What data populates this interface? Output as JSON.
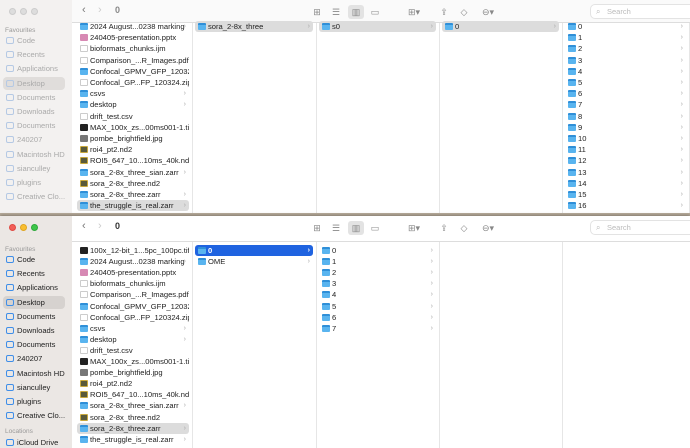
{
  "sidebar": {
    "heading": "Favourites",
    "items": [
      "Code",
      "Recents",
      "Applications",
      "Desktop",
      "Documents",
      "Downloads",
      "Documents",
      "240207",
      "Macintosh HD",
      "sianculley",
      "plugins",
      "Creative Clo..."
    ],
    "selected": "Desktop",
    "locations_heading": "Locations",
    "locations": [
      "iCloud Drive"
    ]
  },
  "window1": {
    "title": "0",
    "columns": [
      [
        {
          "n": "2024 August...0238 marking",
          "t": "folder",
          "c": 1
        },
        {
          "n": "240405-presentation.pptx",
          "t": "ppt"
        },
        {
          "n": "bioformats_chunks.ijm",
          "t": "doc"
        },
        {
          "n": "Comparison_...R_Images.pdf",
          "t": "doc"
        },
        {
          "n": "Confocal_GPMV_GFP_120324",
          "t": "folder",
          "c": 1
        },
        {
          "n": "Confocal_GP...FP_120324.zip",
          "t": "doc"
        },
        {
          "n": "csvs",
          "t": "folder",
          "c": 1
        },
        {
          "n": "desktop",
          "t": "folder",
          "c": 1
        },
        {
          "n": "drift_test.csv",
          "t": "doc"
        },
        {
          "n": "MAX_100x_zs...00ms001-1.tif",
          "t": "img"
        },
        {
          "n": "pombe_brightfield.jpg",
          "t": "jpg"
        },
        {
          "n": "roi4_pt2.nd2",
          "t": "nd2"
        },
        {
          "n": "ROI5_647_10...10ms_40k.nd2",
          "t": "nd2"
        },
        {
          "n": "sora_2-8x_three_sian.zarr",
          "t": "folder",
          "c": 1
        },
        {
          "n": "sora_2-8x_three.nd2",
          "t": "nd2"
        },
        {
          "n": "sora_2-8x_three.zarr",
          "t": "folder",
          "c": 1
        },
        {
          "n": "the_struggle_is_real.zarr",
          "t": "folder",
          "c": 1,
          "s": 1
        }
      ],
      [
        {
          "n": "sora_2-8x_three",
          "t": "folder",
          "c": 1,
          "s": 1
        }
      ],
      [
        {
          "n": "s0",
          "t": "folder",
          "c": 1,
          "s": 1
        }
      ],
      [
        {
          "n": "0",
          "t": "folder",
          "c": 1,
          "s": 1
        }
      ],
      [
        {
          "n": "0",
          "t": "folder",
          "c": 1
        },
        {
          "n": "1",
          "t": "folder",
          "c": 1
        },
        {
          "n": "2",
          "t": "folder",
          "c": 1
        },
        {
          "n": "3",
          "t": "folder",
          "c": 1
        },
        {
          "n": "4",
          "t": "folder",
          "c": 1
        },
        {
          "n": "5",
          "t": "folder",
          "c": 1
        },
        {
          "n": "6",
          "t": "folder",
          "c": 1
        },
        {
          "n": "7",
          "t": "folder",
          "c": 1
        },
        {
          "n": "8",
          "t": "folder",
          "c": 1
        },
        {
          "n": "9",
          "t": "folder",
          "c": 1
        },
        {
          "n": "10",
          "t": "folder",
          "c": 1
        },
        {
          "n": "11",
          "t": "folder",
          "c": 1
        },
        {
          "n": "12",
          "t": "folder",
          "c": 1
        },
        {
          "n": "13",
          "t": "folder",
          "c": 1
        },
        {
          "n": "14",
          "t": "folder",
          "c": 1
        },
        {
          "n": "15",
          "t": "folder",
          "c": 1
        },
        {
          "n": "16",
          "t": "folder",
          "c": 1
        }
      ]
    ]
  },
  "window2": {
    "title": "0",
    "columns": [
      [
        {
          "n": "100x_12-bit_1...5pc_100pc.tif",
          "t": "img"
        },
        {
          "n": "2024 August...0238 marking",
          "t": "folder",
          "c": 1
        },
        {
          "n": "240405-presentation.pptx",
          "t": "ppt"
        },
        {
          "n": "bioformats_chunks.ijm",
          "t": "doc"
        },
        {
          "n": "Comparison_...R_Images.pdf",
          "t": "doc"
        },
        {
          "n": "Confocal_GPMV_GFP_120324",
          "t": "folder",
          "c": 1
        },
        {
          "n": "Confocal_GP...FP_120324.zip",
          "t": "doc"
        },
        {
          "n": "csvs",
          "t": "folder",
          "c": 1
        },
        {
          "n": "desktop",
          "t": "folder",
          "c": 1
        },
        {
          "n": "drift_test.csv",
          "t": "doc"
        },
        {
          "n": "MAX_100x_zs...00ms001-1.tif",
          "t": "img"
        },
        {
          "n": "pombe_brightfield.jpg",
          "t": "jpg"
        },
        {
          "n": "roi4_pt2.nd2",
          "t": "nd2"
        },
        {
          "n": "ROI5_647_10...10ms_40k.nd2",
          "t": "nd2"
        },
        {
          "n": "sora_2-8x_three_sian.zarr",
          "t": "folder",
          "c": 1
        },
        {
          "n": "sora_2-8x_three.nd2",
          "t": "nd2"
        },
        {
          "n": "sora_2-8x_three.zarr",
          "t": "folder",
          "c": 1,
          "s": 1
        },
        {
          "n": "the_struggle_is_real.zarr",
          "t": "folder",
          "c": 1
        }
      ],
      [
        {
          "n": "0",
          "t": "folder",
          "c": 1,
          "a": 1
        },
        {
          "n": "OME",
          "t": "folder",
          "c": 1
        }
      ],
      [
        {
          "n": "0",
          "t": "folder",
          "c": 1
        },
        {
          "n": "1",
          "t": "folder",
          "c": 1
        },
        {
          "n": "2",
          "t": "folder",
          "c": 1
        },
        {
          "n": "3",
          "t": "folder",
          "c": 1
        },
        {
          "n": "4",
          "t": "folder",
          "c": 1
        },
        {
          "n": "5",
          "t": "folder",
          "c": 1
        },
        {
          "n": "6",
          "t": "folder",
          "c": 1
        },
        {
          "n": "7",
          "t": "folder",
          "c": 1
        }
      ],
      []
    ]
  },
  "toolbar": {
    "back": "‹",
    "forward": "›",
    "search_placeholder": "Search",
    "icons": [
      "icon-view-icon",
      "list-view-icon",
      "column-view-icon",
      "gallery-view-icon",
      "group-icon",
      "share-icon",
      "tag-icon",
      "more-icon"
    ],
    "glyphs": [
      "⊞",
      "☰",
      "▥",
      "▭",
      "⊞▾",
      "⇪",
      "◇",
      "⊖▾"
    ]
  }
}
